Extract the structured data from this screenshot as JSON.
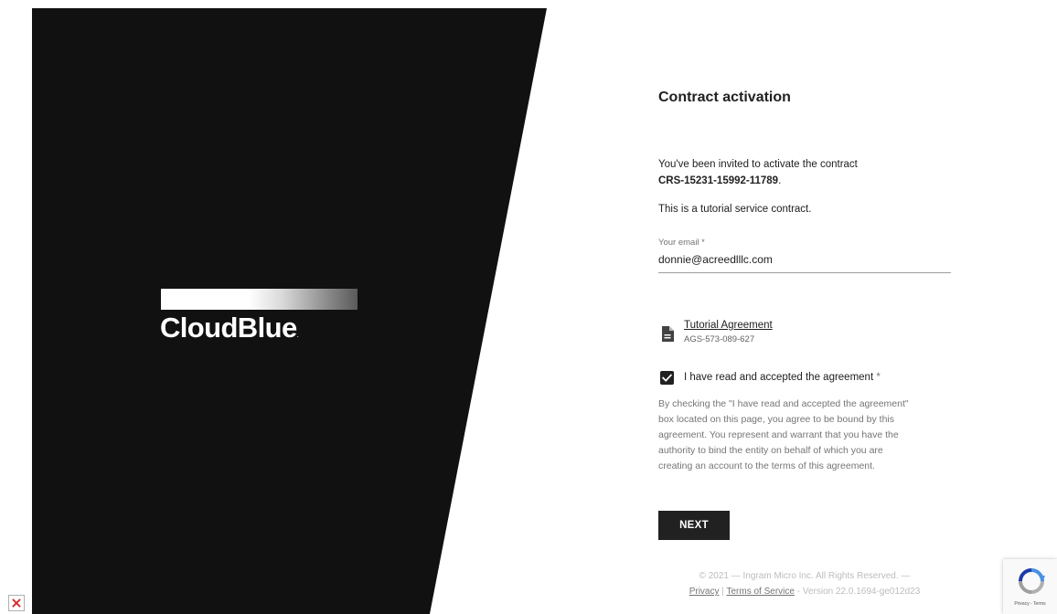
{
  "brand": {
    "logo_text": "CloudBlue",
    "logo_mark": "."
  },
  "form": {
    "title": "Contract activation",
    "invite_text": "You've been invited to activate the contract",
    "contract_id": "CRS-15231-15992-11789",
    "contract_id_suffix": ".",
    "tutorial_text": "This is a tutorial service contract.",
    "email_label": "Your email *",
    "email_value": "donnie@acreedlllc.com",
    "agreement": {
      "icon": "document-icon",
      "title": "Tutorial Agreement",
      "id": "AGS-573-089-627"
    },
    "accept": {
      "checked": true,
      "label": "I have read and accepted the agreement",
      "required_mark": "*"
    },
    "legal_lines": [
      "By checking the \"I have read and accepted the agreement\"",
      "box located on this page, you agree to be bound by this",
      "agreement. You represent and warrant that you have the",
      "authority to bind the entity on behalf of which you are",
      "creating an account to the terms of this agreement."
    ],
    "next_label": "NEXT"
  },
  "footer": {
    "copyright": "© 2021 — Ingram Micro Inc. All Rights Reserved. —",
    "privacy_label": "Privacy",
    "separator": "|",
    "terms_label": "Terms of Service",
    "version_text": "- Version 22.0.1694-ge012d23"
  },
  "recaptcha": {
    "icon": "recaptcha-icon",
    "text": "Privacy - Terms"
  },
  "broken_image": {
    "icon": "broken-image-icon"
  },
  "colors": {
    "hero_background": "#111111",
    "button_background": "#212121",
    "text_primary": "#212121",
    "text_secondary": "#757575"
  }
}
